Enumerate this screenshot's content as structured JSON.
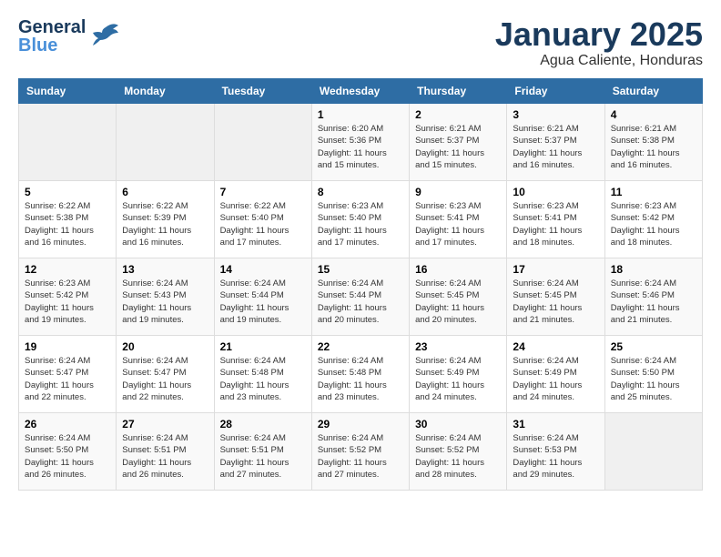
{
  "logo": {
    "general": "General",
    "blue": "Blue",
    "bird_unicode": "🐦"
  },
  "header": {
    "month": "January 2025",
    "location": "Agua Caliente, Honduras"
  },
  "weekdays": [
    "Sunday",
    "Monday",
    "Tuesday",
    "Wednesday",
    "Thursday",
    "Friday",
    "Saturday"
  ],
  "weeks": [
    [
      {
        "day": "",
        "info": ""
      },
      {
        "day": "",
        "info": ""
      },
      {
        "day": "",
        "info": ""
      },
      {
        "day": "1",
        "info": "Sunrise: 6:20 AM\nSunset: 5:36 PM\nDaylight: 11 hours\nand 15 minutes."
      },
      {
        "day": "2",
        "info": "Sunrise: 6:21 AM\nSunset: 5:37 PM\nDaylight: 11 hours\nand 15 minutes."
      },
      {
        "day": "3",
        "info": "Sunrise: 6:21 AM\nSunset: 5:37 PM\nDaylight: 11 hours\nand 16 minutes."
      },
      {
        "day": "4",
        "info": "Sunrise: 6:21 AM\nSunset: 5:38 PM\nDaylight: 11 hours\nand 16 minutes."
      }
    ],
    [
      {
        "day": "5",
        "info": "Sunrise: 6:22 AM\nSunset: 5:38 PM\nDaylight: 11 hours\nand 16 minutes."
      },
      {
        "day": "6",
        "info": "Sunrise: 6:22 AM\nSunset: 5:39 PM\nDaylight: 11 hours\nand 16 minutes."
      },
      {
        "day": "7",
        "info": "Sunrise: 6:22 AM\nSunset: 5:40 PM\nDaylight: 11 hours\nand 17 minutes."
      },
      {
        "day": "8",
        "info": "Sunrise: 6:23 AM\nSunset: 5:40 PM\nDaylight: 11 hours\nand 17 minutes."
      },
      {
        "day": "9",
        "info": "Sunrise: 6:23 AM\nSunset: 5:41 PM\nDaylight: 11 hours\nand 17 minutes."
      },
      {
        "day": "10",
        "info": "Sunrise: 6:23 AM\nSunset: 5:41 PM\nDaylight: 11 hours\nand 18 minutes."
      },
      {
        "day": "11",
        "info": "Sunrise: 6:23 AM\nSunset: 5:42 PM\nDaylight: 11 hours\nand 18 minutes."
      }
    ],
    [
      {
        "day": "12",
        "info": "Sunrise: 6:23 AM\nSunset: 5:42 PM\nDaylight: 11 hours\nand 19 minutes."
      },
      {
        "day": "13",
        "info": "Sunrise: 6:24 AM\nSunset: 5:43 PM\nDaylight: 11 hours\nand 19 minutes."
      },
      {
        "day": "14",
        "info": "Sunrise: 6:24 AM\nSunset: 5:44 PM\nDaylight: 11 hours\nand 19 minutes."
      },
      {
        "day": "15",
        "info": "Sunrise: 6:24 AM\nSunset: 5:44 PM\nDaylight: 11 hours\nand 20 minutes."
      },
      {
        "day": "16",
        "info": "Sunrise: 6:24 AM\nSunset: 5:45 PM\nDaylight: 11 hours\nand 20 minutes."
      },
      {
        "day": "17",
        "info": "Sunrise: 6:24 AM\nSunset: 5:45 PM\nDaylight: 11 hours\nand 21 minutes."
      },
      {
        "day": "18",
        "info": "Sunrise: 6:24 AM\nSunset: 5:46 PM\nDaylight: 11 hours\nand 21 minutes."
      }
    ],
    [
      {
        "day": "19",
        "info": "Sunrise: 6:24 AM\nSunset: 5:47 PM\nDaylight: 11 hours\nand 22 minutes."
      },
      {
        "day": "20",
        "info": "Sunrise: 6:24 AM\nSunset: 5:47 PM\nDaylight: 11 hours\nand 22 minutes."
      },
      {
        "day": "21",
        "info": "Sunrise: 6:24 AM\nSunset: 5:48 PM\nDaylight: 11 hours\nand 23 minutes."
      },
      {
        "day": "22",
        "info": "Sunrise: 6:24 AM\nSunset: 5:48 PM\nDaylight: 11 hours\nand 23 minutes."
      },
      {
        "day": "23",
        "info": "Sunrise: 6:24 AM\nSunset: 5:49 PM\nDaylight: 11 hours\nand 24 minutes."
      },
      {
        "day": "24",
        "info": "Sunrise: 6:24 AM\nSunset: 5:49 PM\nDaylight: 11 hours\nand 24 minutes."
      },
      {
        "day": "25",
        "info": "Sunrise: 6:24 AM\nSunset: 5:50 PM\nDaylight: 11 hours\nand 25 minutes."
      }
    ],
    [
      {
        "day": "26",
        "info": "Sunrise: 6:24 AM\nSunset: 5:50 PM\nDaylight: 11 hours\nand 26 minutes."
      },
      {
        "day": "27",
        "info": "Sunrise: 6:24 AM\nSunset: 5:51 PM\nDaylight: 11 hours\nand 26 minutes."
      },
      {
        "day": "28",
        "info": "Sunrise: 6:24 AM\nSunset: 5:51 PM\nDaylight: 11 hours\nand 27 minutes."
      },
      {
        "day": "29",
        "info": "Sunrise: 6:24 AM\nSunset: 5:52 PM\nDaylight: 11 hours\nand 27 minutes."
      },
      {
        "day": "30",
        "info": "Sunrise: 6:24 AM\nSunset: 5:52 PM\nDaylight: 11 hours\nand 28 minutes."
      },
      {
        "day": "31",
        "info": "Sunrise: 6:24 AM\nSunset: 5:53 PM\nDaylight: 11 hours\nand 29 minutes."
      },
      {
        "day": "",
        "info": ""
      }
    ]
  ]
}
